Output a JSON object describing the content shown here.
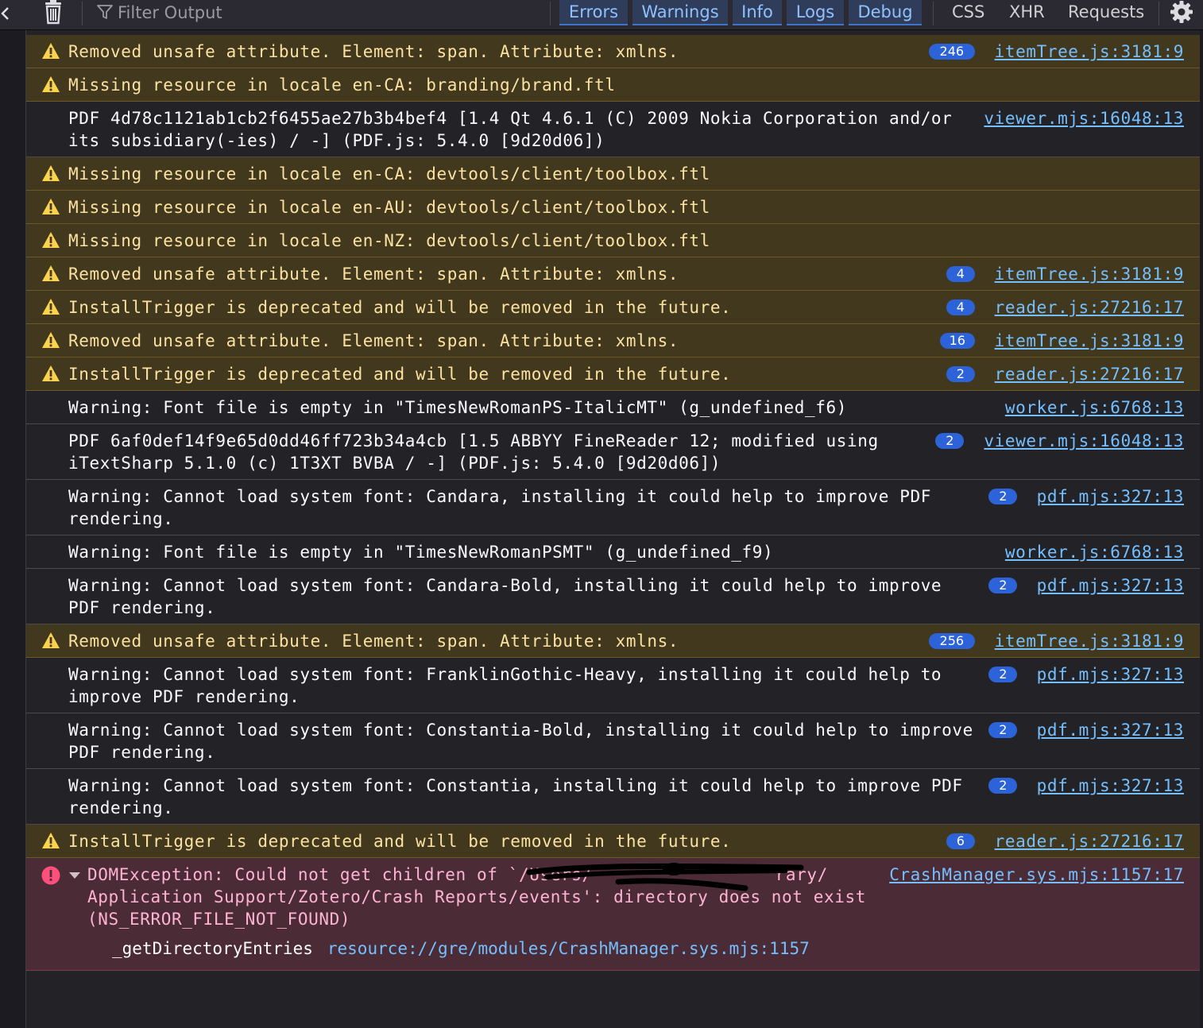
{
  "toolbar": {
    "filter_placeholder": "Filter Output",
    "levels": [
      "Errors",
      "Warnings",
      "Info",
      "Logs",
      "Debug"
    ],
    "requests": [
      "CSS",
      "XHR",
      "Requests"
    ]
  },
  "messages": [
    {
      "type": "warn",
      "text": "Removed unsafe attribute. Element: span. Attribute: xmlns.",
      "count": "246",
      "location": "itemTree.js:3181:9"
    },
    {
      "type": "warn",
      "text": "Missing resource in locale en-CA: branding/brand.ftl",
      "count": "",
      "location": ""
    },
    {
      "type": "log",
      "text": "PDF 4d78c1121ab1cb2f6455ae27b3b4bef4 [1.4 Qt 4.6.1 (C) 2009 Nokia Corporation and/or\nits subsidiary(-ies) / -] (PDF.js: 5.4.0 [9d20d06])",
      "count": "",
      "location": "viewer.mjs:16048:13"
    },
    {
      "type": "warn",
      "text": "Missing resource in locale en-CA: devtools/client/toolbox.ftl",
      "count": "",
      "location": ""
    },
    {
      "type": "warn",
      "text": "Missing resource in locale en-AU: devtools/client/toolbox.ftl",
      "count": "",
      "location": ""
    },
    {
      "type": "warn",
      "text": "Missing resource in locale en-NZ: devtools/client/toolbox.ftl",
      "count": "",
      "location": ""
    },
    {
      "type": "warn",
      "text": "Removed unsafe attribute. Element: span. Attribute: xmlns.",
      "count": "4",
      "location": "itemTree.js:3181:9"
    },
    {
      "type": "warn",
      "text": "InstallTrigger is deprecated and will be removed in the future.",
      "count": "4",
      "location": "reader.js:27216:17"
    },
    {
      "type": "warn",
      "text": "Removed unsafe attribute. Element: span. Attribute: xmlns.",
      "count": "16",
      "location": "itemTree.js:3181:9"
    },
    {
      "type": "warn",
      "text": "InstallTrigger is deprecated and will be removed in the future.",
      "count": "2",
      "location": "reader.js:27216:17"
    },
    {
      "type": "log",
      "text": "Warning: Font file is empty in \"TimesNewRomanPS-ItalicMT\" (g_undefined_f6)",
      "count": "",
      "location": "worker.js:6768:13"
    },
    {
      "type": "log",
      "text": "PDF 6af0def14f9e65d0dd46ff723b34a4cb [1.5 ABBYY FineReader 12; modified using\niTextSharp 5.1.0 (c) 1T3XT BVBA / -] (PDF.js: 5.4.0 [9d20d06])",
      "count": "2",
      "location": "viewer.mjs:16048:13"
    },
    {
      "type": "log",
      "text": "Warning: Cannot load system font: Candara, installing it could help to improve PDF\nrendering.",
      "count": "2",
      "location": "pdf.mjs:327:13"
    },
    {
      "type": "log",
      "text": "Warning: Font file is empty in \"TimesNewRomanPSMT\" (g_undefined_f9)",
      "count": "",
      "location": "worker.js:6768:13"
    },
    {
      "type": "log",
      "text": "Warning: Cannot load system font: Candara-Bold, installing it could help to improve\nPDF rendering.",
      "count": "2",
      "location": "pdf.mjs:327:13"
    },
    {
      "type": "warn",
      "text": "Removed unsafe attribute. Element: span. Attribute: xmlns.",
      "count": "256",
      "location": "itemTree.js:3181:9"
    },
    {
      "type": "log",
      "text": "Warning: Cannot load system font: FranklinGothic-Heavy, installing it could help to\nimprove PDF rendering.",
      "count": "2",
      "location": "pdf.mjs:327:13"
    },
    {
      "type": "log",
      "text": "Warning: Cannot load system font: Constantia-Bold, installing it could help to improve\nPDF rendering.",
      "count": "2",
      "location": "pdf.mjs:327:13"
    },
    {
      "type": "log",
      "text": "Warning: Cannot load system font: Constantia, installing it could help to improve PDF\nrendering.",
      "count": "2",
      "location": "pdf.mjs:327:13"
    },
    {
      "type": "warn",
      "text": "InstallTrigger is deprecated and will be removed in the future.",
      "count": "6",
      "location": "reader.js:27216:17"
    }
  ],
  "error": {
    "text": "DOMException: Could not get children of `/Users/",
    "text_rest": "rary/\nApplication Support/Zotero/Crash Reports/events': directory does not exist\n(NS_ERROR_FILE_NOT_FOUND)",
    "location": "CrashManager.sys.mjs:1157:17",
    "stack_fn": "_getDirectoryEntries",
    "stack_location": "resource://gre/modules/CrashManager.sys.mjs:1157"
  },
  "colors": {
    "warn_bg": "#42381e",
    "warn_text": "#fce2a1",
    "error_bg": "#4b2c36",
    "error_text": "#ffb3d2",
    "link": "#75bfff",
    "badge": "#2d63d8"
  }
}
